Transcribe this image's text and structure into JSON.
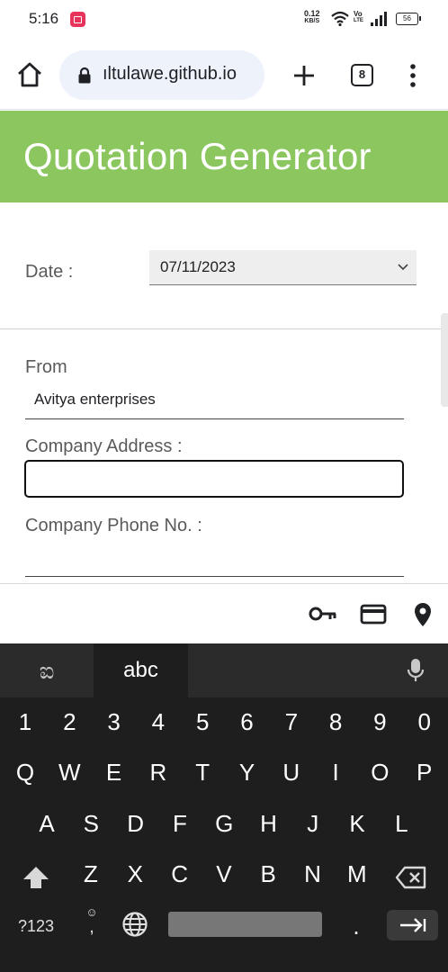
{
  "status_bar": {
    "time": "5:16",
    "net_speed_value": "0.12",
    "net_speed_unit": "KB/S",
    "volte_top": "Vo",
    "volte_bottom": "LTE",
    "battery": "56"
  },
  "browser": {
    "url": "ıltulawe.github.io",
    "tab_count": "8"
  },
  "page": {
    "title": "Quotation Generator",
    "date_label": "Date :",
    "date_value": "07/11/2023",
    "from_label": "From",
    "from_value": "Avitya enterprises",
    "company_address_label": "Company Address :",
    "company_address_value": "",
    "company_phone_label": "Company Phone No. :",
    "company_phone_value": ""
  },
  "keyboard": {
    "lang_native": "ಐ",
    "lang_abc": "abc",
    "row_numbers": [
      "1",
      "2",
      "3",
      "4",
      "5",
      "6",
      "7",
      "8",
      "9",
      "0"
    ],
    "row_1": [
      "Q",
      "W",
      "E",
      "R",
      "T",
      "Y",
      "U",
      "I",
      "O",
      "P"
    ],
    "row_2": [
      "A",
      "S",
      "D",
      "F",
      "G",
      "H",
      "J",
      "K",
      "L"
    ],
    "row_3": [
      "Z",
      "X",
      "C",
      "V",
      "B",
      "N",
      "M"
    ],
    "symbols_key": "?123",
    "emoji_comma": ",",
    "period": "."
  }
}
